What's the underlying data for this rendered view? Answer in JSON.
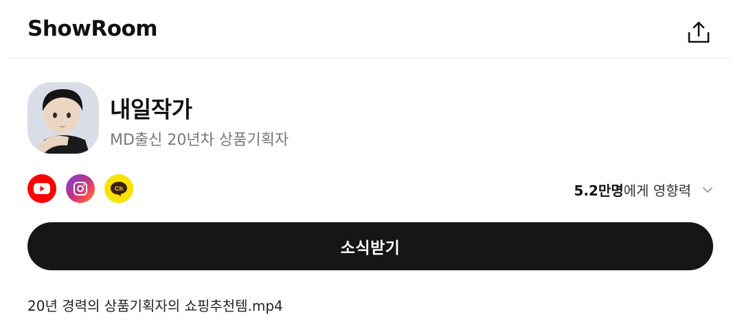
{
  "header": {
    "title": "ShowRoom",
    "share_icon": "share-icon"
  },
  "profile": {
    "name": "내일작가",
    "description": "MD출신 20년차 상품기획자",
    "avatar_icon": "avatar-image"
  },
  "social": {
    "links": [
      {
        "icon": "youtube-icon",
        "color": "#ff0000"
      },
      {
        "icon": "instagram-icon",
        "color": "#c13584"
      },
      {
        "icon": "kakao-channel-icon",
        "color": "#fae100"
      }
    ],
    "kakao_label": "Ch"
  },
  "influence": {
    "count": "5.2만명",
    "suffix": "에게 영향력",
    "chevron_icon": "chevron-down-icon"
  },
  "subscribe_label": "소식받기",
  "video_title": "20년 경력의 상품기획자의 쇼핑추천템.mp4"
}
